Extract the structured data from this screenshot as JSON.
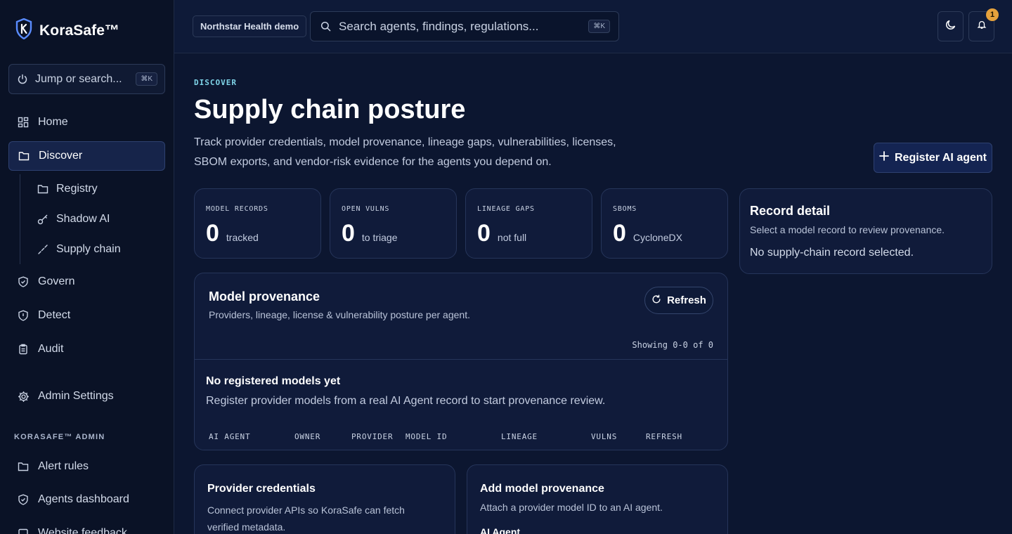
{
  "brand": {
    "name": "KoraSafe™"
  },
  "sidebar": {
    "jump_label": "Jump or search...",
    "jump_shortcut": "⌘K",
    "items": [
      {
        "label": "Home"
      },
      {
        "label": "Discover"
      },
      {
        "label": "Registry"
      },
      {
        "label": "Shadow AI"
      },
      {
        "label": "Supply chain"
      },
      {
        "label": "Govern"
      },
      {
        "label": "Detect"
      },
      {
        "label": "Audit"
      },
      {
        "label": "Admin Settings"
      }
    ],
    "admin_section": "KORASAFE™ ADMIN",
    "admin_items": [
      {
        "label": "Alert rules"
      },
      {
        "label": "Agents dashboard"
      },
      {
        "label": "Website feedback"
      }
    ]
  },
  "topbar": {
    "org": "Northstar Health demo",
    "search_placeholder": "Search agents, findings, regulations...",
    "search_shortcut": "⌘K",
    "notification_count": "1"
  },
  "page": {
    "eyebrow": "DISCOVER",
    "title": "Supply chain posture",
    "description": "Track provider credentials, model provenance, lineage gaps, vulnerabilities, licenses, SBOM exports, and vendor-risk evidence for the agents you depend on.",
    "primary_action": "Register AI agent"
  },
  "stats": [
    {
      "label": "MODEL RECORDS",
      "value": "0",
      "sub": "tracked"
    },
    {
      "label": "OPEN VULNS",
      "value": "0",
      "sub": "to triage"
    },
    {
      "label": "LINEAGE GAPS",
      "value": "0",
      "sub": "not full"
    },
    {
      "label": "SBOMS",
      "value": "0",
      "sub": "CycloneDX"
    }
  ],
  "record_detail": {
    "title": "Record detail",
    "subtitle": "Select a model record to review provenance.",
    "empty": "No supply-chain record selected."
  },
  "provenance": {
    "title": "Model provenance",
    "subtitle": "Providers, lineage, license & vulnerability posture per agent.",
    "refresh": "Refresh",
    "showing": "Showing 0-0 of 0",
    "empty_title": "No registered models yet",
    "empty_text": "Register provider models from a real AI Agent record to start provenance review.",
    "columns": [
      "AI AGENT",
      "OWNER",
      "PROVIDER",
      "MODEL ID",
      "LINEAGE",
      "VULNS",
      "REFRESH"
    ]
  },
  "credentials": {
    "title": "Provider credentials",
    "subtitle": "Connect provider APIs so KoraSafe can fetch verified metadata."
  },
  "add_provenance": {
    "title": "Add model provenance",
    "subtitle": "Attach a provider model ID to an AI agent.",
    "field_label": "AI Agent"
  },
  "colors": {
    "accent": "#7fd4e8",
    "badge": "#e6a23c",
    "background": "#0c1630"
  }
}
